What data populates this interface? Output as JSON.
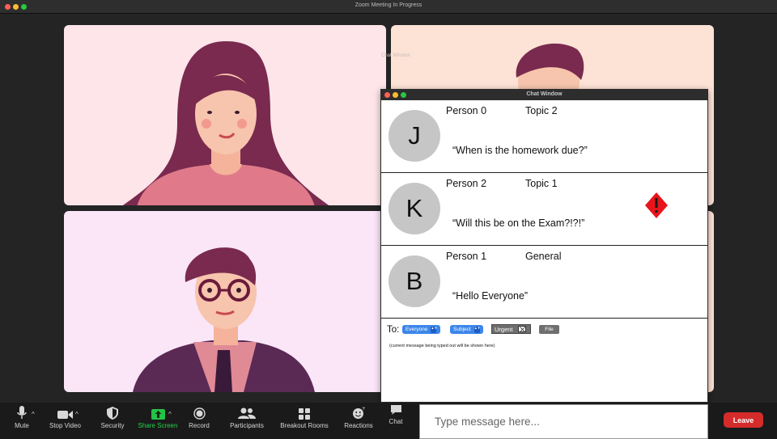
{
  "window": {
    "title": "Zoom Meeting In Progress"
  },
  "ghost_label": "Chat Window",
  "chat": {
    "title": "Chat Window",
    "messages": [
      {
        "avatar": "J",
        "sender": "Person 0",
        "topic": "Topic 2",
        "text": "“When is the homework due?”",
        "urgent": false
      },
      {
        "avatar": "K",
        "sender": "Person 2",
        "topic": "Topic 1",
        "text": "“Will this be on the Exam?!?!”",
        "urgent": true
      },
      {
        "avatar": "B",
        "sender": "Person 1",
        "topic": "General",
        "text": "“Hello Everyone”",
        "urgent": false
      }
    ],
    "composer": {
      "to_label": "To:",
      "recipient": "Everyone",
      "subject": "Subject",
      "urgent_label": "Urgent",
      "file_label": "File",
      "draft_placeholder": "(current message being typed out will be shown here)"
    }
  },
  "toolbar": {
    "mute": "Mute",
    "stop_video": "Stop Video",
    "security": "Security",
    "share_screen": "Share Screen",
    "record": "Record",
    "participants": "Participants",
    "breakout_rooms": "Breakout Rooms",
    "reactions": "Reactions",
    "chat": "Chat",
    "leave": "Leave"
  },
  "message_input": {
    "placeholder": "Type message here..."
  },
  "colors": {
    "accent_green": "#24c247",
    "leave_red": "#d52b2b",
    "urgent_red": "#e8141b",
    "select_blue": "#3c86ea"
  },
  "icons": [
    "microphone-icon",
    "video-camera-icon",
    "shield-icon",
    "share-arrow-icon",
    "record-icon",
    "participants-icon",
    "breakout-grid-icon",
    "reactions-smiley-icon",
    "chat-bubble-icon",
    "urgent-diamond-icon"
  ]
}
